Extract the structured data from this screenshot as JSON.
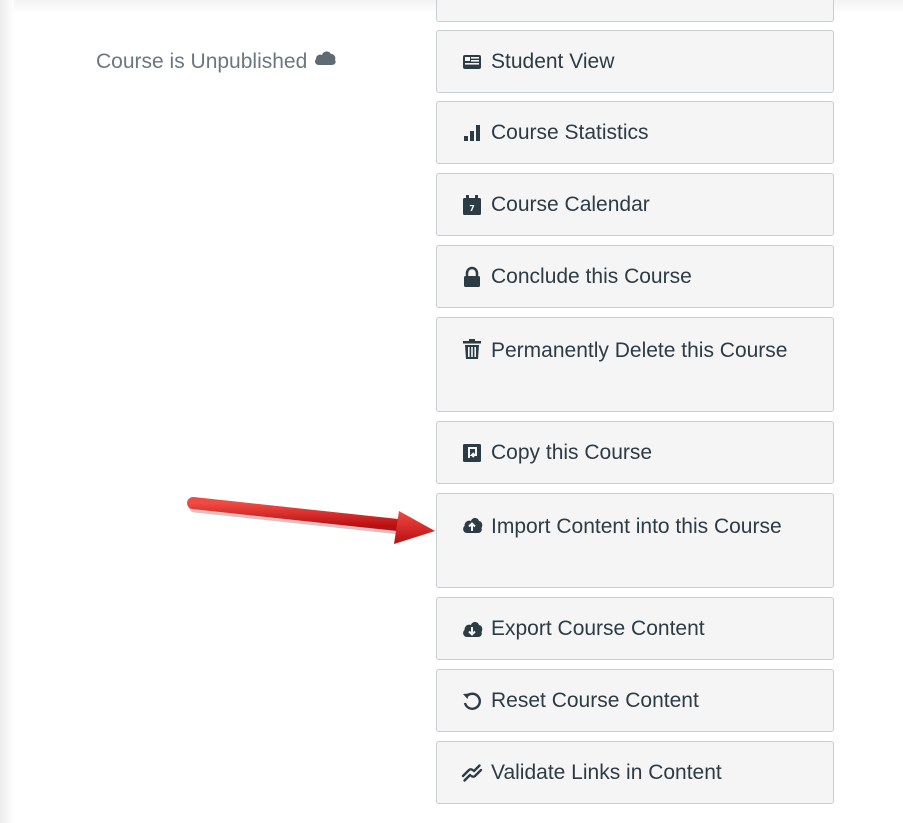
{
  "status": {
    "text": "Course is Unpublished",
    "icon": "cloud-icon"
  },
  "buttons": [
    {
      "label": "Student View",
      "icon": "student-view-icon"
    },
    {
      "label": "Course Statistics",
      "icon": "bar-chart-icon"
    },
    {
      "label": "Course Calendar",
      "icon": "calendar-icon"
    },
    {
      "label": "Conclude this Course",
      "icon": "lock-icon"
    },
    {
      "label": "Permanently Delete this Course",
      "icon": "trash-icon"
    },
    {
      "label": "Copy this Course",
      "icon": "copy-icon"
    },
    {
      "label": "Import Content into this Course",
      "icon": "cloud-upload-icon"
    },
    {
      "label": "Export Course Content",
      "icon": "cloud-download-icon"
    },
    {
      "label": "Reset Course Content",
      "icon": "reset-icon"
    },
    {
      "label": "Validate Links in Content",
      "icon": "link-icon"
    }
  ],
  "annotation": {
    "arrow_color": "#d9181b",
    "points_to": "Import Content into this Course"
  }
}
